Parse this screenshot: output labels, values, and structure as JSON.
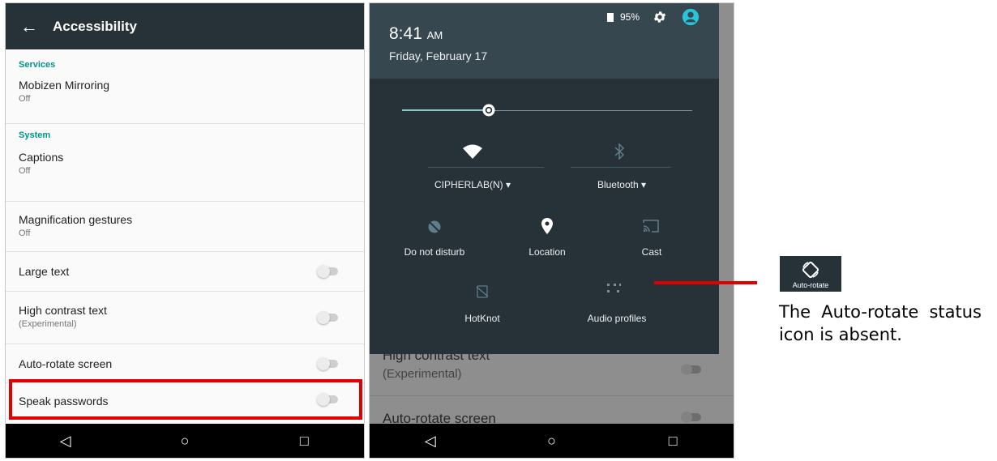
{
  "left_screen": {
    "title": "Accessibility",
    "back_glyph": "←",
    "sections": {
      "services": "Services",
      "system": "System"
    },
    "items": [
      {
        "title": "Mobizen Mirroring",
        "subtitle": "Off"
      },
      {
        "title": "Captions",
        "subtitle": "Off"
      },
      {
        "title": "Magnification gestures",
        "subtitle": "Off"
      },
      {
        "title": "Large text",
        "toggle": "off"
      },
      {
        "title": "High contrast text",
        "subtitle": "(Experimental)",
        "toggle": "off"
      },
      {
        "title": "Auto-rotate screen",
        "toggle": "off",
        "highlighted": true
      },
      {
        "title": "Speak passwords",
        "toggle": "off"
      }
    ],
    "nav": {
      "back": "◁",
      "home": "○",
      "recents": "□"
    }
  },
  "right_screen": {
    "time": "8:41",
    "ampm": "AM",
    "date": "Friday, February 17",
    "battery": "95%",
    "brightness_level": 0.3,
    "tiles": [
      {
        "label": "CIPHERLAB(N) ▾",
        "icon": "wifi-icon"
      },
      {
        "label": "Bluetooth ▾",
        "icon": "bluetooth-icon"
      },
      {
        "label": "Do not disturb",
        "icon": "do-not-disturb-icon"
      },
      {
        "label": "Location",
        "icon": "location-icon"
      },
      {
        "label": "Cast",
        "icon": "cast-icon"
      },
      {
        "label": "HotKnot",
        "icon": "hotknot-icon"
      },
      {
        "label": "Audio profiles",
        "icon": "audio-profiles-icon"
      }
    ],
    "background_items": [
      {
        "title": "High contrast text",
        "subtitle": "(Experimental)"
      },
      {
        "title": "Auto-rotate screen"
      }
    ],
    "nav": {
      "back": "◁",
      "home": "○",
      "recents": "□"
    }
  },
  "callout": {
    "tile_label": "Auto-rotate",
    "caption": "The Auto-rotate status icon is absent.",
    "line_color": "#e00000"
  },
  "colors": {
    "appbar": "#263238",
    "accent": "#009688",
    "highlight": "#e00000",
    "shade": "#263238"
  }
}
